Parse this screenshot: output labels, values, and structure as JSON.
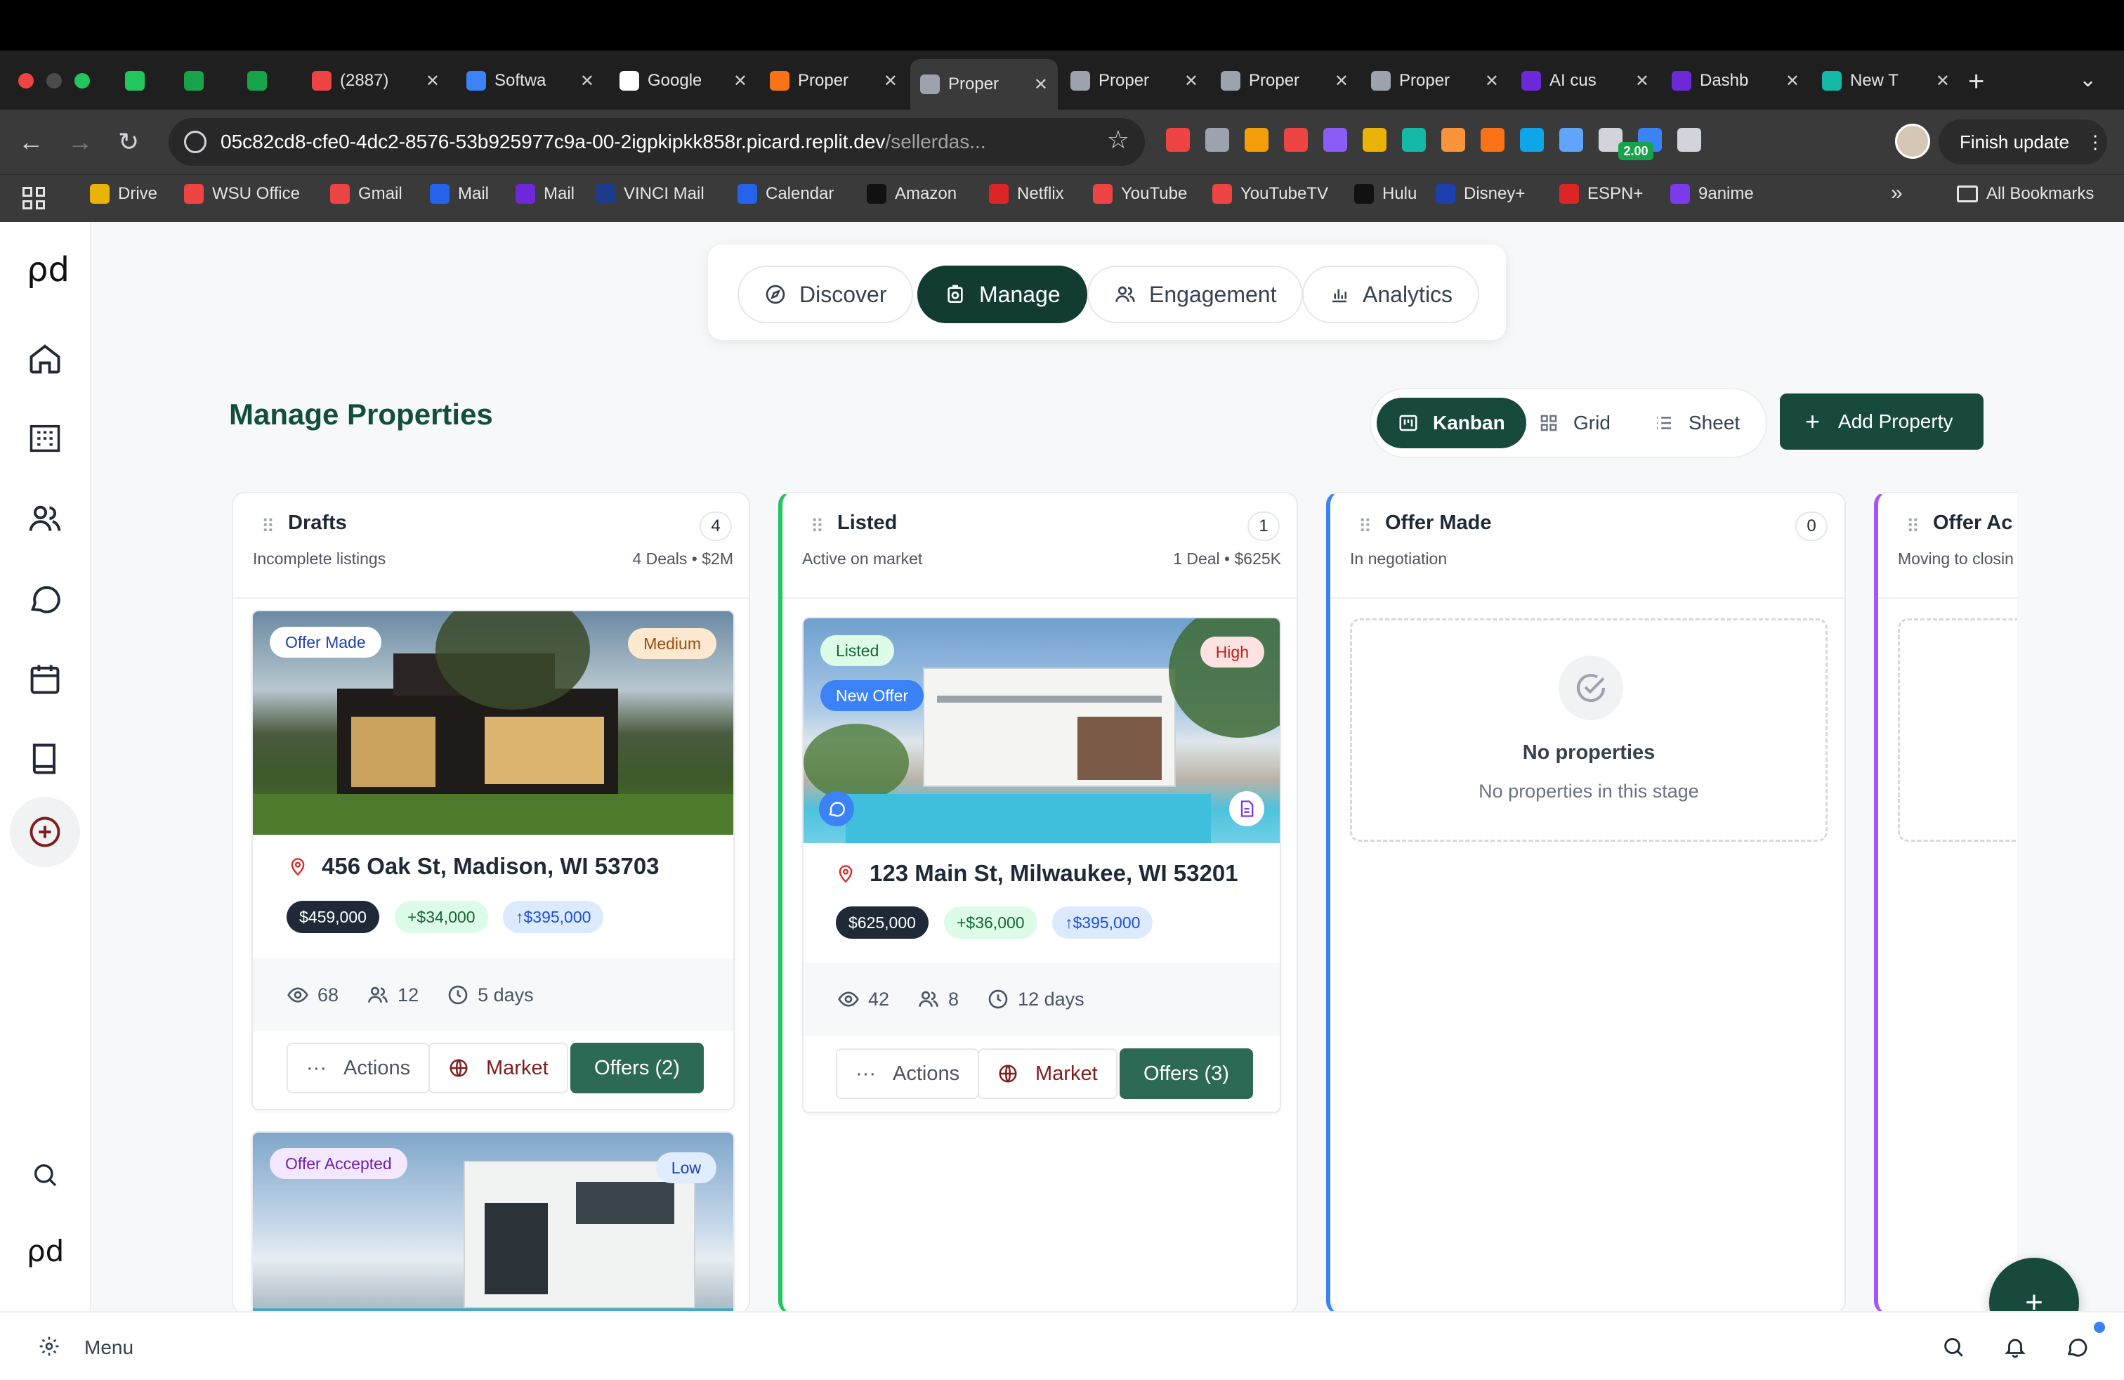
{
  "browser": {
    "tabs": [
      {
        "title": "",
        "icon": "replit-icon",
        "color": "#22c55e"
      },
      {
        "title": "",
        "icon": "sheets-icon",
        "color": "#16a34a"
      },
      {
        "title": "",
        "icon": "sheets-icon",
        "color": "#16a34a"
      },
      {
        "title": "(2887)",
        "icon": "youtube-icon",
        "color": "#ef4444"
      },
      {
        "title": "Softwa",
        "icon": "docs-icon",
        "color": "#3b82f6"
      },
      {
        "title": "Google",
        "icon": "openai-icon",
        "color": "#ffffff"
      },
      {
        "title": "Proper",
        "icon": "orange-app-icon",
        "color": "#f97316"
      },
      {
        "title": "Proper",
        "icon": "globe-icon",
        "color": "#9ca3af"
      },
      {
        "title": "Proper",
        "icon": "globe-icon",
        "color": "#9ca3af"
      },
      {
        "title": "Proper",
        "icon": "globe-icon",
        "color": "#9ca3af"
      },
      {
        "title": "Proper",
        "icon": "globe-icon",
        "color": "#9ca3af"
      },
      {
        "title": "AI cus",
        "icon": "purple-app-icon",
        "color": "#6d28d9"
      },
      {
        "title": "Dashb",
        "icon": "purple-app-icon",
        "color": "#6d28d9"
      },
      {
        "title": "New T",
        "icon": "m-app-icon",
        "color": "#14b8a6"
      }
    ],
    "url_main": "05c82cd8-cfe0-4dc2-8576-53b925977c9a-00-2igpkipkk858r.picard.replit.dev",
    "url_path": "/sellerdas...",
    "finish_update": "Finish update",
    "extension_badge": "2.00",
    "bookmarks": [
      {
        "label": "Drive",
        "color": "#eab308"
      },
      {
        "label": "WSU Office",
        "color": "#ef4444"
      },
      {
        "label": "Gmail",
        "color": "#ef4444"
      },
      {
        "label": "Mail",
        "color": "#2563eb"
      },
      {
        "label": "Mail",
        "color": "#6d28d9"
      },
      {
        "label": "VINCI Mail",
        "color": "#1e3a8a"
      },
      {
        "label": "Calendar",
        "color": "#2563eb"
      },
      {
        "label": "Amazon",
        "color": "#111111"
      },
      {
        "label": "Netflix",
        "color": "#dc2626"
      },
      {
        "label": "YouTube",
        "color": "#ef4444"
      },
      {
        "label": "YouTubeTV",
        "color": "#ef4444"
      },
      {
        "label": "Hulu",
        "color": "#111111"
      },
      {
        "label": "Disney+",
        "color": "#1e40af"
      },
      {
        "label": "ESPN+",
        "color": "#dc2626"
      },
      {
        "label": "9anime",
        "color": "#7c3aed"
      }
    ],
    "all_bookmarks": "All Bookmarks"
  },
  "topnav": {
    "discover": "Discover",
    "manage": "Manage",
    "engagement": "Engagement",
    "analytics": "Analytics"
  },
  "page": {
    "title": "Manage Properties",
    "views": {
      "kanban": "Kanban",
      "grid": "Grid",
      "sheet": "Sheet"
    },
    "add_property": "Add Property"
  },
  "columns": [
    {
      "name": "Drafts",
      "count": "4",
      "subtitle": "Incomplete listings",
      "stats": "4 Deals • $2M",
      "accent": "#e5e7eb"
    },
    {
      "name": "Listed",
      "count": "1",
      "subtitle": "Active on market",
      "stats": "1 Deal • $625K",
      "accent": "#22c55e"
    },
    {
      "name": "Offer Made",
      "count": "0",
      "subtitle": "In negotiation",
      "stats": "",
      "accent": "#3b82f6"
    },
    {
      "name": "Offer Ac",
      "count": "",
      "subtitle": "Moving to closin",
      "stats": "",
      "accent": "#a855f7"
    }
  ],
  "cards": [
    {
      "status": "Offer Made",
      "priority": "Medium",
      "address": "456 Oak St, Madison, WI 53703",
      "price": "$459,000",
      "gain": "+$34,000",
      "base": "↑$395,000",
      "views": "68",
      "people": "12",
      "days": "5 days",
      "actions": "Actions",
      "market": "Market",
      "offers": "Offers (2)"
    },
    {
      "status": "Listed",
      "status2": "New Offer",
      "priority": "High",
      "address": "123 Main St, Milwaukee, WI 53201",
      "price": "$625,000",
      "gain": "+$36,000",
      "base": "↑$395,000",
      "views": "42",
      "people": "8",
      "days": "12 days",
      "actions": "Actions",
      "market": "Market",
      "offers": "Offers (3)"
    },
    {
      "status": "Offer Accepted",
      "priority": "Low"
    }
  ],
  "empty_state": {
    "title": "No properties",
    "subtitle": "No properties in this stage"
  },
  "bottom": {
    "menu": "Menu"
  },
  "colors": {
    "brand_dark": "#174a3c",
    "title_green": "#134e3a"
  }
}
